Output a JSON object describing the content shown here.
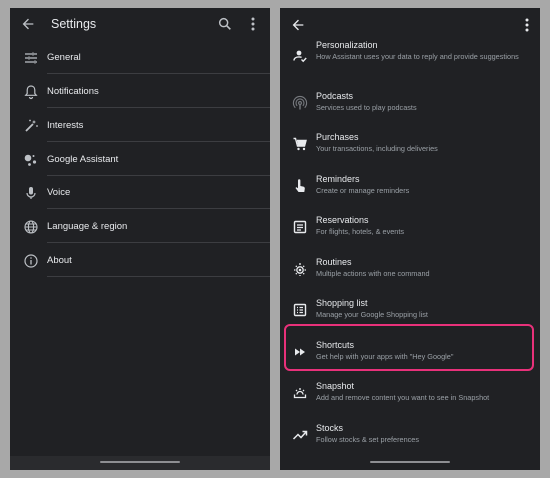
{
  "left_panel": {
    "title": "Settings",
    "icons": {
      "back": "back-arrow-icon",
      "search": "search-icon",
      "more": "more-vert-icon"
    },
    "items": [
      {
        "label": "General",
        "icon": "tune-icon"
      },
      {
        "label": "Notifications",
        "icon": "bell-icon"
      },
      {
        "label": "Interests",
        "icon": "magic-wand-icon"
      },
      {
        "label": "Google Assistant",
        "icon": "assistant-icon"
      },
      {
        "label": "Voice",
        "icon": "mic-icon"
      },
      {
        "label": "Language & region",
        "icon": "globe-icon"
      },
      {
        "label": "About",
        "icon": "info-icon"
      }
    ]
  },
  "right_panel": {
    "icons": {
      "back": "back-arrow-icon",
      "more": "more-vert-icon"
    },
    "items": [
      {
        "title": "Personalization",
        "subtitle": "How Assistant uses your data to reply and provide suggestions",
        "icon": "person-check-icon"
      },
      {
        "title": "Podcasts",
        "subtitle": "Services used to play podcasts",
        "icon": "podcast-icon"
      },
      {
        "title": "Purchases",
        "subtitle": "Your transactions, including deliveries",
        "icon": "cart-icon"
      },
      {
        "title": "Reminders",
        "subtitle": "Create or manage reminders",
        "icon": "reminder-hand-icon"
      },
      {
        "title": "Reservations",
        "subtitle": "For flights, hotels, & events",
        "icon": "reservation-icon"
      },
      {
        "title": "Routines",
        "subtitle": "Multiple actions with one command",
        "icon": "routines-icon"
      },
      {
        "title": "Shopping list",
        "subtitle": "Manage your Google Shopping list",
        "icon": "list-icon"
      },
      {
        "title": "Shortcuts",
        "subtitle": "Get help with your apps with \"Hey Google\"",
        "icon": "fast-forward-icon"
      },
      {
        "title": "Snapshot",
        "subtitle": "Add and remove content you want to see in Snapshot",
        "icon": "snapshot-icon"
      },
      {
        "title": "Stocks",
        "subtitle": "Follow stocks & set preferences",
        "icon": "trending-up-icon"
      }
    ]
  },
  "colors": {
    "background": "#202124",
    "highlight": "#e8317a",
    "text": "#e8eaed",
    "subtext": "#9aa0a6"
  }
}
